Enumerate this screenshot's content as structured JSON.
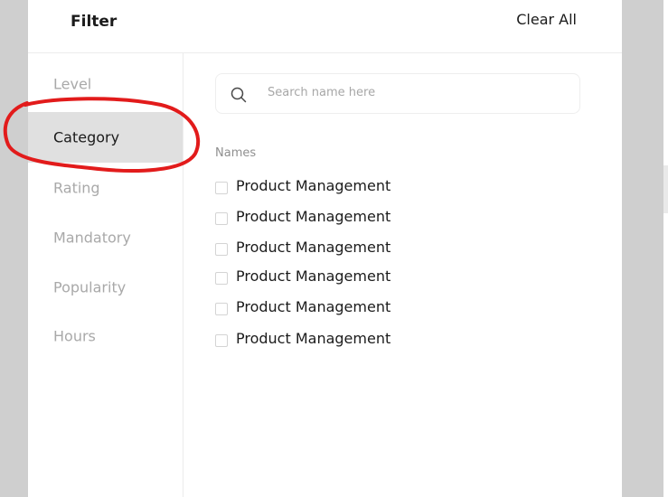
{
  "header": {
    "title": "Filter",
    "clear_all": "Clear All"
  },
  "sidebar": {
    "items": [
      {
        "label": "Level",
        "active": false
      },
      {
        "label": "Category",
        "active": true
      },
      {
        "label": "Rating",
        "active": false
      },
      {
        "label": "Mandatory",
        "active": false
      },
      {
        "label": "Popularity",
        "active": false
      },
      {
        "label": "Hours",
        "active": false
      }
    ]
  },
  "search": {
    "placeholder": "Search name here",
    "icon": "search-icon"
  },
  "names": {
    "label": "Names",
    "options": [
      {
        "label": "Product Management",
        "checked": false
      },
      {
        "label": "Product Management",
        "checked": false
      },
      {
        "label": "Product Management",
        "checked": false
      },
      {
        "label": "Product Management",
        "checked": false
      },
      {
        "label": "Product Management",
        "checked": false
      },
      {
        "label": "Product Management",
        "checked": false
      }
    ]
  },
  "colors": {
    "annotation": "#e21b1b",
    "active_bg": "#e0e0e0",
    "inactive_text": "#a9a9a9"
  }
}
